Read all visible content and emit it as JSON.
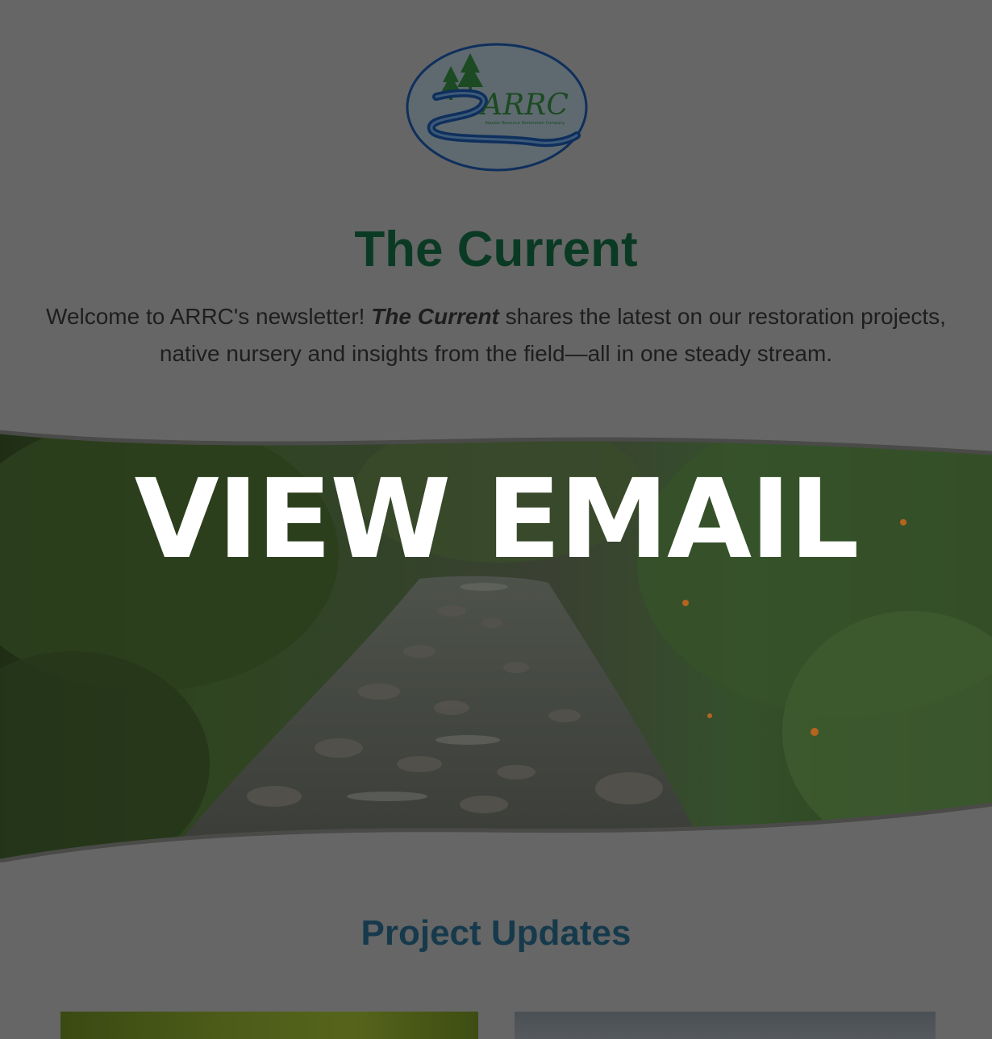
{
  "logo": {
    "text": "ARRC",
    "tagline": "Aquatic Resource Restoration Company",
    "icon": "arrc-logo-icon"
  },
  "header": {
    "title": "The Current"
  },
  "intro": {
    "lead": "Welcome to ARRC's newsletter! ",
    "emphasis": "The Current",
    "rest": " shares the latest on our restoration projects, native nursery and insights from the field—all in one steady stream."
  },
  "hero": {
    "cta_label": "VIEW EMAIL",
    "image": "stream-photo"
  },
  "section": {
    "heading": "Project Updates"
  },
  "colors": {
    "background": "#666666",
    "title": "#0b3a24",
    "section_heading": "#163a4c",
    "cta_text": "#ffffff"
  }
}
